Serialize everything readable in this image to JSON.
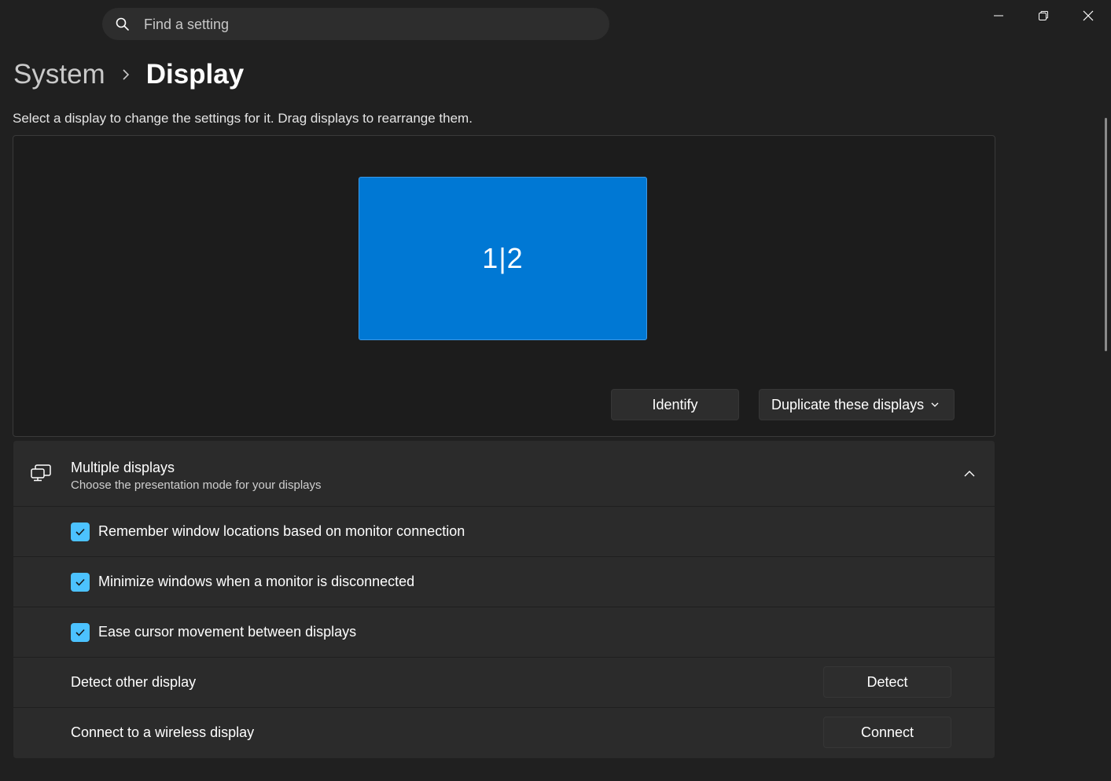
{
  "search": {
    "placeholder": "Find a setting",
    "icon": "search-icon"
  },
  "window_controls": {
    "minimize_icon": "minimize-icon",
    "restore_icon": "restore-icon",
    "close_icon": "close-icon"
  },
  "breadcrumb": {
    "parent": "System",
    "current": "Display"
  },
  "arrangement": {
    "hint": "Select a display to change the settings for it. Drag displays to rearrange them.",
    "monitor_label": "1|2",
    "identify_label": "Identify",
    "mode_label": "Duplicate these displays"
  },
  "multiple_displays": {
    "title": "Multiple displays",
    "subtitle": "Choose the presentation mode for your displays",
    "expanded": true,
    "options": [
      {
        "label": "Remember window locations based on monitor connection",
        "checked": true
      },
      {
        "label": "Minimize windows when a monitor is disconnected",
        "checked": true
      },
      {
        "label": "Ease cursor movement between displays",
        "checked": true
      }
    ],
    "detect": {
      "label": "Detect other display",
      "button": "Detect"
    },
    "connect": {
      "label": "Connect to a wireless display",
      "button": "Connect"
    }
  },
  "colors": {
    "accent": "#0078d4",
    "checkbox": "#4cc2ff",
    "background": "#202020",
    "card": "#2b2b2b"
  }
}
